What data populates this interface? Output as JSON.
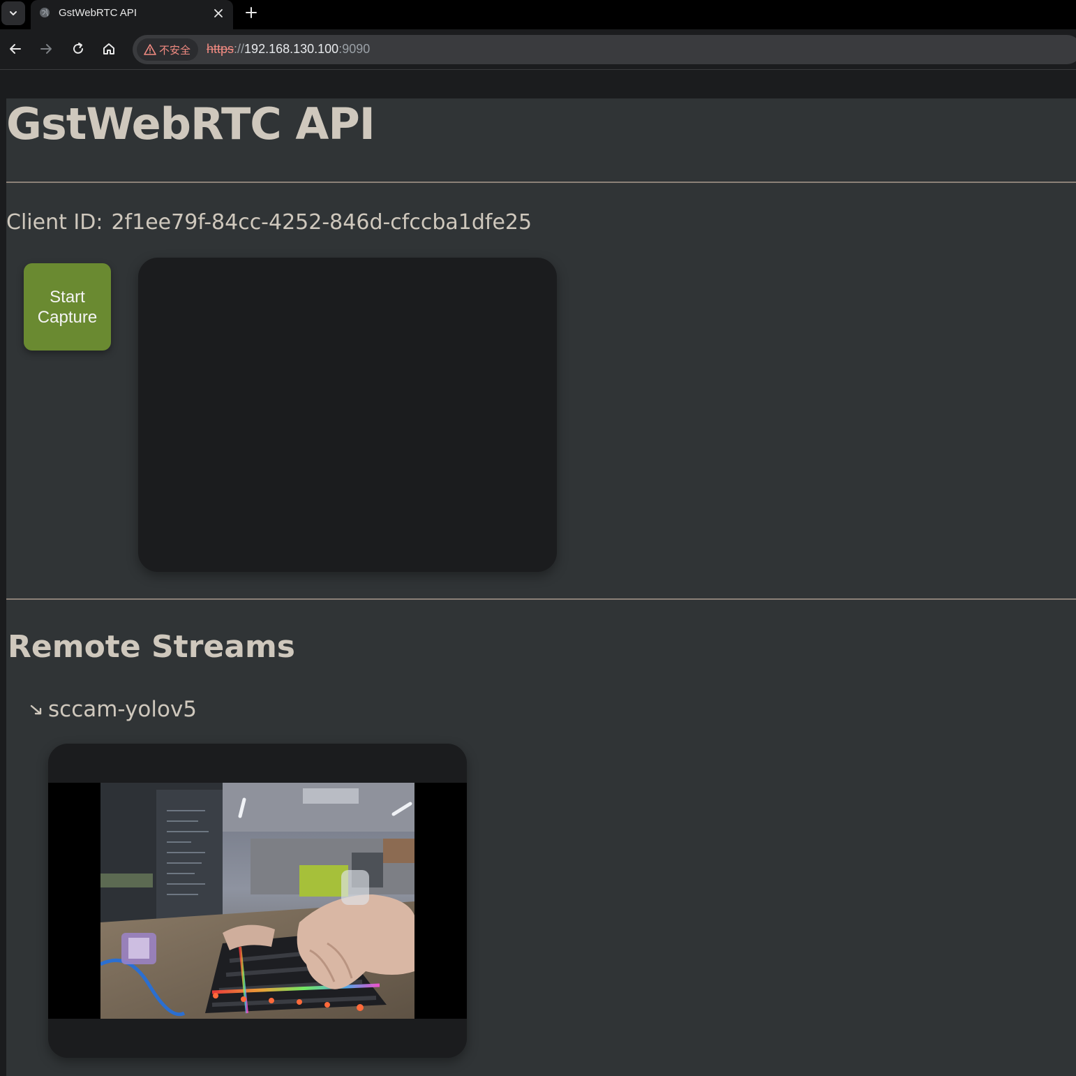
{
  "browser": {
    "tab_title": "GstWebRTC API",
    "security_label": "不安全",
    "url_scheme": "https",
    "url_sep": "://",
    "url_host": "192.168.130.100",
    "url_port": ":9090"
  },
  "page": {
    "title": "GstWebRTC API",
    "client_id_label": "Client ID:",
    "client_id_value": "2f1ee79f-84cc-4252-846d-cfccba1dfe25",
    "start_button_label": "Start Capture",
    "remote_section_title": "Remote Streams",
    "streams": [
      {
        "name": "sccam-yolov5"
      }
    ]
  },
  "colors": {
    "page_bg": "#303436",
    "text": "#cfc8bd",
    "button_green": "#6a8a31",
    "video_bg": "#1b1c1e",
    "insecure_red": "#f28b82"
  },
  "icons": {
    "tab_menu": "chevron-down-icon",
    "favicon": "globe-icon",
    "tab_close": "close-icon",
    "new_tab": "plus-icon",
    "back": "arrow-left-icon",
    "forward": "arrow-right-icon",
    "reload": "reload-icon",
    "home": "home-icon",
    "warning": "warning-triangle-icon",
    "stream_toggle": "arrow-down-right-icon"
  }
}
